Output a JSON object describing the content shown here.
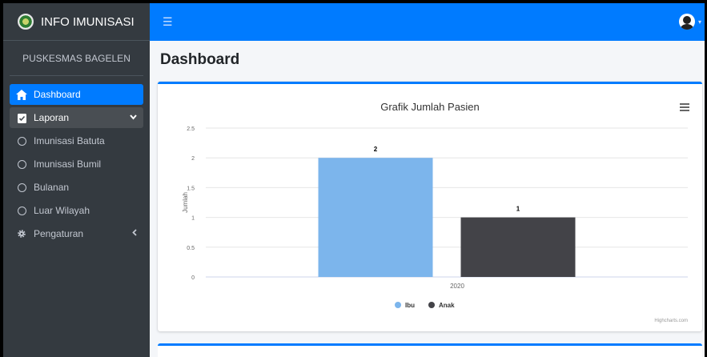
{
  "brand": {
    "title": "INFO IMUNISASI"
  },
  "org": {
    "name": "PUSKESMAS BAGELEN"
  },
  "sidebar": {
    "items": [
      {
        "label": "Dashboard",
        "icon": "home-icon",
        "active": true
      },
      {
        "label": "Laporan",
        "icon": "clipboard-check-icon",
        "open": true
      },
      {
        "label": "Imunisasi Batuta",
        "icon": "circle-icon"
      },
      {
        "label": "Imunisasi Bumil",
        "icon": "circle-icon"
      },
      {
        "label": "Bulanan",
        "icon": "circle-icon"
      },
      {
        "label": "Luar Wilayah",
        "icon": "circle-icon"
      },
      {
        "label": "Pengaturan",
        "icon": "gear-icon"
      }
    ]
  },
  "header": {
    "menu_icon": "hamburger-icon",
    "user_icon": "user-avatar-icon"
  },
  "page": {
    "title": "Dashboard"
  },
  "chart_data": {
    "type": "bar",
    "title": "Grafik Jumlah Pasien",
    "categories": [
      "2020"
    ],
    "series": [
      {
        "name": "Ibu",
        "values": [
          2
        ],
        "color": "#7cb5ec"
      },
      {
        "name": "Anak",
        "values": [
          1
        ],
        "color": "#434348"
      }
    ],
    "ylabel": "Jumlah",
    "ylim": [
      0,
      2.5
    ],
    "yticks": [
      "0",
      "0.5",
      "1",
      "1.5",
      "2",
      "2.5"
    ],
    "grid": true,
    "legend": "bottom-center",
    "credits": "Highcharts.com"
  },
  "colors": {
    "accent": "#007bff",
    "sidebar": "#343a40"
  }
}
